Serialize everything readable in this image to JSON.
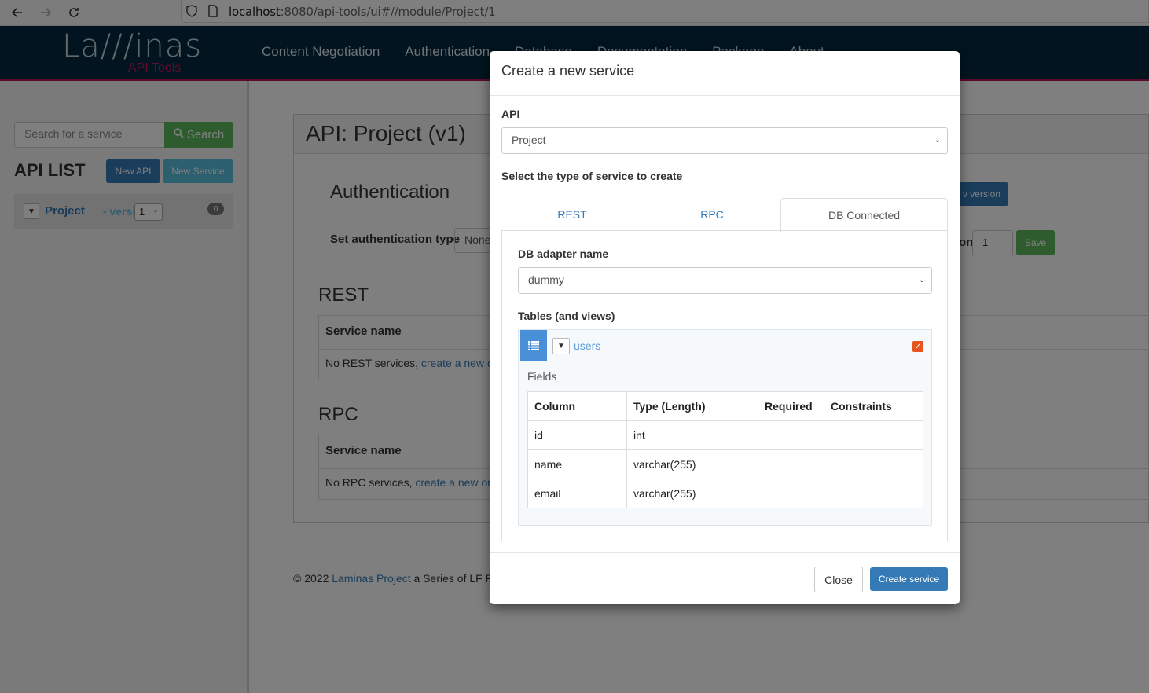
{
  "browser": {
    "url_host": "localhost",
    "url_rest": ":8080/api-tools/ui#//module/Project/1"
  },
  "header": {
    "logo": "La///inas",
    "logo_sub": "API Tools",
    "nav": [
      "Content Negotiation",
      "Authentication",
      "Database",
      "Documentation",
      "Package",
      "About"
    ]
  },
  "sidebar": {
    "search_placeholder": "Search for a service",
    "search_button": "Search",
    "api_list_title": "API LIST",
    "new_api": "New API",
    "new_service": "New Service",
    "api_name": "Project",
    "api_version_label": "- version",
    "api_version": "1",
    "api_badge": "0"
  },
  "main": {
    "title": "API: Project (v1)",
    "auth_title": "Authentication",
    "auth_label": "Set authentication type",
    "auth_value": "None",
    "new_version": "v version",
    "version_label": "on",
    "version_value": "1",
    "save": "Save",
    "rest_title": "REST",
    "rest_header": "Service name",
    "rest_empty": "No REST services, ",
    "rest_link": "create a new o",
    "rpc_title": "RPC",
    "rpc_header": "Service name",
    "rpc_empty": "No RPC services, ",
    "rpc_link": "create a new or",
    "footer_prefix": "© 2022 ",
    "footer_link": "Laminas Project",
    "footer_suffix": " a Series of LF P"
  },
  "modal": {
    "title": "Create a new service",
    "api_label": "API",
    "api_value": "Project",
    "type_label": "Select the type of service to create",
    "tabs": [
      "REST",
      "RPC",
      "DB Connected"
    ],
    "adapter_label": "DB adapter name",
    "adapter_value": "dummy",
    "tables_label": "Tables (and views)",
    "table_name": "users",
    "fields_label": "Fields",
    "columns": [
      "Column",
      "Type (Length)",
      "Required",
      "Constraints"
    ],
    "rows": [
      [
        "id",
        "int",
        "",
        ""
      ],
      [
        "name",
        "varchar(255)",
        "",
        ""
      ],
      [
        "email",
        "varchar(255)",
        "",
        ""
      ]
    ],
    "close": "Close",
    "create": "Create service"
  },
  "colors": {
    "header_bg": "#03293e",
    "accent": "#b6155b",
    "primary": "#337ab7",
    "success": "#5cb85c",
    "info": "#5bc0de",
    "checkbox": "#e8541e"
  }
}
